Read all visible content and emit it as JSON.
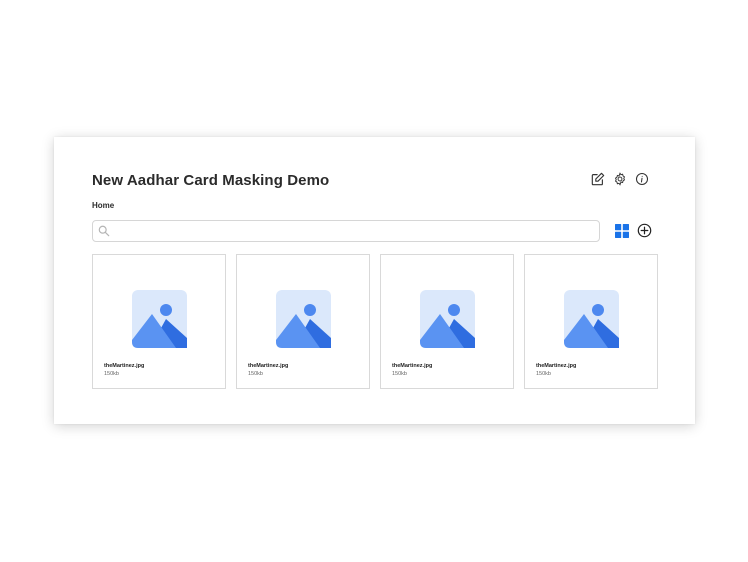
{
  "header": {
    "title": "New Aadhar Card Masking Demo",
    "icons": [
      "edit-icon",
      "gear-icon",
      "info-icon"
    ]
  },
  "breadcrumb": {
    "label": "Home"
  },
  "search": {
    "placeholder": "",
    "value": ""
  },
  "toolbar": {
    "view_icon": "grid-view-icon",
    "add_icon": "add-circle-icon"
  },
  "colors": {
    "accent": "#1a73e8",
    "thumb_bg": "#dbe8fb",
    "thumb_mountain_back": "#2f6de0",
    "thumb_mountain_front": "#5a93f2",
    "thumb_sun": "#4d88ef"
  },
  "files": [
    {
      "name": "theMartinez.jpg",
      "size": "150kb"
    },
    {
      "name": "theMartinez.jpg",
      "size": "150kb"
    },
    {
      "name": "theMartinez.jpg",
      "size": "150kb"
    },
    {
      "name": "theMartinez.jpg",
      "size": "150kb"
    }
  ]
}
